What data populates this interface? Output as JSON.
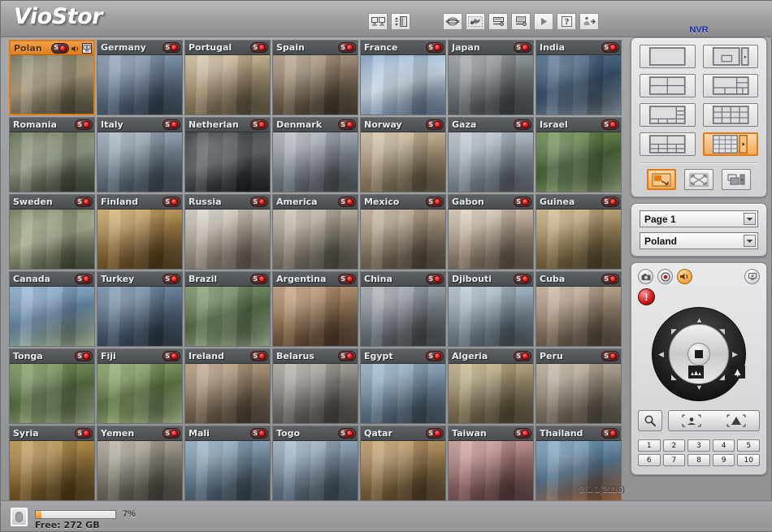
{
  "app": {
    "logo": "VioStor",
    "nvr_label": "NVR",
    "version": "3.1.1(2116)",
    "accent_color": "#e07b18",
    "record_color": "#d31414",
    "nvr_label_color": "#1b2ea8"
  },
  "toolbar": {
    "group1": [
      {
        "name": "monitor-pair-icon",
        "label": "Multi-Server Monitoring"
      },
      {
        "name": "sort-list-icon",
        "label": "Arrange Channels"
      }
    ],
    "group2": [
      {
        "name": "globe-icon",
        "label": "Remote Server"
      },
      {
        "name": "settings-gear-icon",
        "label": "Configuration"
      },
      {
        "name": "server-connect-icon",
        "label": "Server Connection"
      },
      {
        "name": "monitor-connect-icon",
        "label": "Monitor Connection"
      },
      {
        "name": "play-icon",
        "label": "Playback"
      },
      {
        "name": "help-icon",
        "label": "Help"
      },
      {
        "name": "logout-icon",
        "label": "Logout"
      }
    ]
  },
  "cameras": [
    {
      "name": "Polan",
      "full_name": "Poland",
      "selected": true,
      "recording": true,
      "status": "S",
      "audio": true,
      "ptz": true,
      "c1": "#6e7056",
      "c2": "#a89878",
      "c3": "#4d4f3d"
    },
    {
      "name": "Germany",
      "selected": false,
      "recording": true,
      "status": "S",
      "c1": "#8ba0b8",
      "c2": "#5d6f86",
      "c3": "#33404f"
    },
    {
      "name": "Portugal",
      "selected": false,
      "recording": true,
      "status": "S",
      "c1": "#d8c9a8",
      "c2": "#9c8a6a",
      "c3": "#5e5440"
    },
    {
      "name": "Spain",
      "selected": false,
      "recording": true,
      "status": "S",
      "c1": "#b9a68e",
      "c2": "#7b6a55",
      "c3": "#3f382c"
    },
    {
      "name": "France",
      "selected": false,
      "recording": true,
      "status": "S",
      "c1": "#86a8cc",
      "c2": "#c9d6e2",
      "c3": "#5a7490"
    },
    {
      "name": "Japan",
      "selected": false,
      "recording": true,
      "status": "S",
      "c1": "#9fa6aa",
      "c2": "#6c7376",
      "c3": "#40454a"
    },
    {
      "name": "India",
      "selected": false,
      "recording": true,
      "status": "S",
      "c1": "#4f6f8e",
      "c2": "#2d4560",
      "c3": "#8c9aa5"
    },
    {
      "name": "Romania",
      "selected": false,
      "recording": true,
      "status": "S",
      "c1": "#5a6b47",
      "c2": "#8d9581",
      "c3": "#343d2c"
    },
    {
      "name": "Italy",
      "selected": false,
      "recording": true,
      "status": "S",
      "c1": "#a7b6c3",
      "c2": "#6d7d8b",
      "c3": "#3d4752"
    },
    {
      "name": "Netherlan",
      "full_name": "Netherlands",
      "selected": false,
      "recording": true,
      "status": "S",
      "c1": "#2e3438",
      "c2": "#585f64",
      "c3": "#15181a"
    },
    {
      "name": "Denmark",
      "selected": false,
      "recording": true,
      "status": "S",
      "c1": "#b7bec6",
      "c2": "#7d858d",
      "c3": "#4a5158"
    },
    {
      "name": "Norway",
      "selected": false,
      "recording": true,
      "status": "S",
      "c1": "#d6c6a6",
      "c2": "#9b8b6d",
      "c3": "#5f5440"
    },
    {
      "name": "Gaza",
      "selected": false,
      "recording": true,
      "status": "S",
      "c1": "#c3ccd4",
      "c2": "#8e98a2",
      "c3": "#586068"
    },
    {
      "name": "Israel",
      "selected": false,
      "recording": true,
      "status": "S",
      "c1": "#6f8f52",
      "c2": "#3e5a2e",
      "c3": "#9aab83"
    },
    {
      "name": "Sweden",
      "selected": false,
      "recording": true,
      "status": "S",
      "c1": "#6d7d54",
      "c2": "#a3a98c",
      "c3": "#3d4630"
    },
    {
      "name": "Finland",
      "selected": false,
      "recording": true,
      "status": "S",
      "c1": "#d9b56c",
      "c2": "#8e6d36",
      "c3": "#4e3c1e"
    },
    {
      "name": "Russia",
      "selected": false,
      "recording": true,
      "status": "S",
      "c1": "#dcd6cc",
      "c2": "#a59c8f",
      "c3": "#6a6158"
    },
    {
      "name": "America",
      "selected": false,
      "recording": true,
      "status": "S",
      "c1": "#ccc4b4",
      "c2": "#8e8676",
      "c3": "#55504a"
    },
    {
      "name": "Mexico",
      "selected": false,
      "recording": true,
      "status": "S",
      "c1": "#c9b7a0",
      "c2": "#8a7a66",
      "c3": "#4f463a"
    },
    {
      "name": "Gabon",
      "selected": false,
      "recording": true,
      "status": "S",
      "c1": "#e2d4c2",
      "c2": "#a08f7c",
      "c3": "#5e5246"
    },
    {
      "name": "Guinea",
      "selected": false,
      "recording": true,
      "status": "S",
      "c1": "#d6c08e",
      "c2": "#8f7a50",
      "c3": "#4f442c"
    },
    {
      "name": "Canada",
      "selected": false,
      "recording": true,
      "status": "S",
      "c1": "#93b7d8",
      "c2": "#5e7e9c",
      "c3": "#b9c9a0"
    },
    {
      "name": "Turkey",
      "selected": false,
      "recording": true,
      "status": "S",
      "c1": "#7c97b3",
      "c2": "#4c6278",
      "c3": "#2b3744"
    },
    {
      "name": "Brazil",
      "selected": false,
      "recording": true,
      "status": "S",
      "c1": "#7e9b6c",
      "c2": "#4d6340",
      "c3": "#a9bc9a"
    },
    {
      "name": "Argentina",
      "selected": false,
      "recording": true,
      "status": "S",
      "c1": "#c8a07c",
      "c2": "#8a6b4c",
      "c3": "#4d3b2a"
    },
    {
      "name": "China",
      "selected": false,
      "recording": true,
      "status": "S",
      "c1": "#aab2b8",
      "c2": "#737b82",
      "c3": "#454b50"
    },
    {
      "name": "Djibouti",
      "selected": false,
      "recording": true,
      "status": "S",
      "c1": "#b8ccd8",
      "c2": "#7e8f9c",
      "c3": "#4a555e"
    },
    {
      "name": "Cuba",
      "selected": false,
      "recording": true,
      "status": "S",
      "c1": "#cdb9a3",
      "c2": "#8e7c68",
      "c3": "#51463a"
    },
    {
      "name": "Tonga",
      "selected": false,
      "recording": true,
      "status": "S",
      "c1": "#7e9a5e",
      "c2": "#4e6338",
      "c3": "#a8b890"
    },
    {
      "name": "Fiji",
      "selected": false,
      "recording": true,
      "status": "S",
      "c1": "#8fae68",
      "c2": "#566c3c",
      "c3": "#b4c594"
    },
    {
      "name": "Ireland",
      "selected": false,
      "recording": true,
      "status": "S",
      "c1": "#c0a888",
      "c2": "#84715a",
      "c3": "#4a4034"
    },
    {
      "name": "Belarus",
      "selected": false,
      "recording": true,
      "status": "S",
      "c1": "#b6b2aa",
      "c2": "#7c7872",
      "c3": "#484542"
    },
    {
      "name": "Egypt",
      "selected": false,
      "recording": true,
      "status": "S",
      "c1": "#9fbacf",
      "c2": "#6a8296",
      "c3": "#3c4b58"
    },
    {
      "name": "Algeria",
      "selected": false,
      "recording": true,
      "status": "S",
      "c1": "#c9b98e",
      "c2": "#8c7e5c",
      "c3": "#524a36"
    },
    {
      "name": "Peru",
      "selected": false,
      "recording": true,
      "status": "S",
      "c1": "#c6b9a6",
      "c2": "#8a806f",
      "c3": "#514a40"
    },
    {
      "name": "Syria",
      "selected": false,
      "recording": true,
      "status": "S",
      "c1": "#c59a4e",
      "c2": "#8a6a2e",
      "c3": "#4e3c1a"
    },
    {
      "name": "Yemen",
      "selected": false,
      "recording": true,
      "status": "S",
      "c1": "#b8b0a2",
      "c2": "#7e786c",
      "c3": "#4a4640"
    },
    {
      "name": "Mali",
      "selected": false,
      "recording": true,
      "status": "S",
      "c1": "#9ab4c8",
      "c2": "#647c8e",
      "c3": "#3a4752"
    },
    {
      "name": "Togo",
      "selected": false,
      "recording": true,
      "status": "S",
      "c1": "#a8bccc",
      "c2": "#6e8292",
      "c3": "#414e58"
    },
    {
      "name": "Qatar",
      "selected": false,
      "recording": true,
      "status": "S",
      "c1": "#caa36a",
      "c2": "#8c7044",
      "c3": "#4f4026"
    },
    {
      "name": "Taiwan",
      "selected": false,
      "recording": true,
      "status": "S",
      "c1": "#d6a3a0",
      "c2": "#96696a",
      "c3": "#553c3d"
    },
    {
      "name": "Thailand",
      "selected": false,
      "recording": true,
      "status": "S",
      "c1": "#7fa8c6",
      "c2": "#4e6e88",
      "c3": "#b06a3c"
    }
  ],
  "layout_panel": {
    "buttons": [
      {
        "name": "layout-1ch",
        "cols": 1,
        "rows": 1,
        "label": "1 Channel",
        "active": false,
        "variant": "single"
      },
      {
        "name": "layout-1plus",
        "cols": 1,
        "rows": 1,
        "label": "1 + Sidebar",
        "active": false,
        "variant": "pip-side"
      },
      {
        "name": "layout-4ch",
        "cols": 2,
        "rows": 2,
        "label": "4 Channels",
        "active": false,
        "variant": "grid"
      },
      {
        "name": "layout-6ch",
        "cols": 3,
        "rows": 3,
        "label": "6 Channels",
        "active": false,
        "variant": "six"
      },
      {
        "name": "layout-8ch",
        "cols": 4,
        "rows": 3,
        "label": "8 Channels",
        "active": false,
        "variant": "eight"
      },
      {
        "name": "layout-12ch",
        "cols": 4,
        "rows": 3,
        "label": "12 Channels",
        "active": false,
        "variant": "grid"
      },
      {
        "name": "layout-9ch",
        "cols": 3,
        "rows": 3,
        "label": "9 Channels",
        "active": false,
        "variant": "nine"
      },
      {
        "name": "layout-16ch",
        "cols": 4,
        "rows": 4,
        "label": "16 Channels",
        "active": true,
        "variant": "grid-side"
      }
    ],
    "modes": [
      {
        "name": "mode-sequence-button",
        "label": "Auto Sequence",
        "active": true
      },
      {
        "name": "mode-fullscreen-button",
        "label": "Full Screen",
        "active": false
      },
      {
        "name": "mode-multiwindow-button",
        "label": "Multi-Window",
        "active": false
      }
    ]
  },
  "selectors": {
    "page": {
      "label": "Page 1",
      "name": "page-select"
    },
    "camera": {
      "label": "Poland",
      "name": "camera-select"
    }
  },
  "ptz": {
    "snapshot_label": "Snapshot",
    "record_label": "Manual Record",
    "audio_label": "Audio",
    "ptz_camera_label": "PTZ Camera",
    "alarm_label": "Alarm Output",
    "zoom_out_label": "Zoom Out",
    "zoom_in_label": "Zoom In",
    "stop_label": "Stop",
    "search_label": "Search",
    "focus_near_label": "Focus Near",
    "focus_far_label": "Focus Far",
    "presets": [
      "1",
      "2",
      "3",
      "4",
      "5",
      "6",
      "7",
      "8",
      "9",
      "10"
    ]
  },
  "status": {
    "free_label": "Free: 272 GB",
    "percent_label": "7%",
    "percent_value": 7,
    "disk_icon": "hard-disk-icon"
  }
}
